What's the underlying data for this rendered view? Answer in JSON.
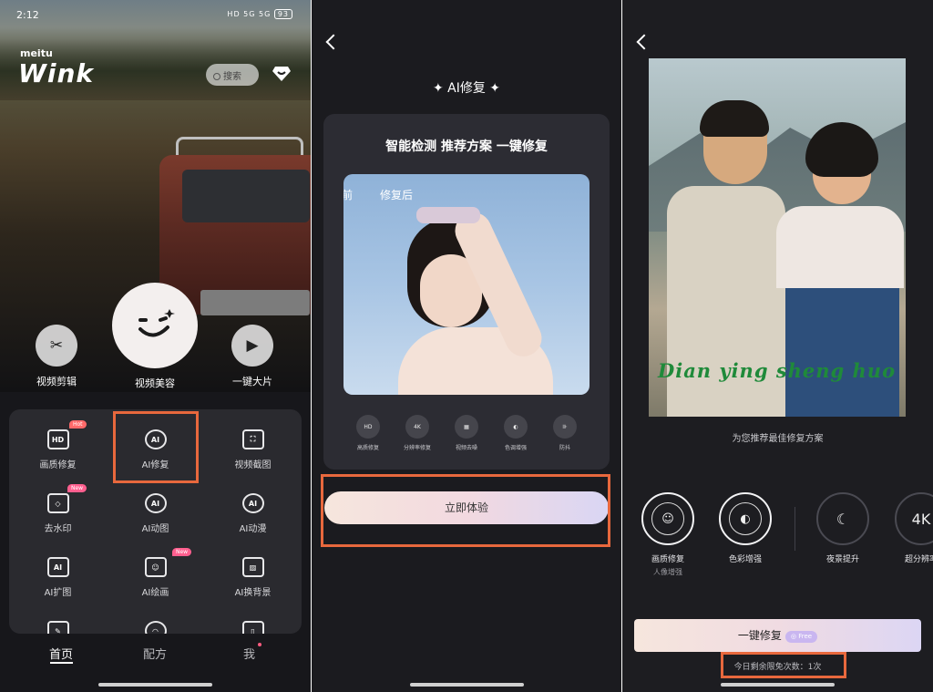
{
  "panel1": {
    "status": {
      "time": "2:12",
      "signal": "HD 5G 5G",
      "battery": "93"
    },
    "brand": {
      "top": "meitu",
      "name": "Wink"
    },
    "search_placeholder": "搜索",
    "features": [
      {
        "label": "视频剪辑",
        "icon": "scissors-icon"
      },
      {
        "label": "视频美容",
        "icon": "face-wink-icon"
      },
      {
        "label": "一键大片",
        "icon": "play-icon"
      }
    ],
    "tools": [
      {
        "label": "画质修复",
        "icon": "hd-icon",
        "tag": "Hot"
      },
      {
        "label": "AI修复",
        "icon": "ai-repair-icon",
        "tag": ""
      },
      {
        "label": "视频截图",
        "icon": "screenshot-icon",
        "tag": ""
      },
      {
        "label": "去水印",
        "icon": "eraser-icon",
        "tag": "New"
      },
      {
        "label": "AI动图",
        "icon": "ai-animate-icon",
        "tag": ""
      },
      {
        "label": "AI动漫",
        "icon": "ai-anime-icon",
        "tag": ""
      },
      {
        "label": "AI扩图",
        "icon": "ai-expand-icon",
        "tag": ""
      },
      {
        "label": "AI绘画",
        "icon": "ai-paint-icon",
        "tag": "New"
      },
      {
        "label": "AI换背景",
        "icon": "ai-background-icon",
        "tag": ""
      }
    ],
    "nav": {
      "home": "首页",
      "recipe": "配方",
      "me": "我"
    }
  },
  "panel2": {
    "title": "AI修复",
    "headline": "智能检测 推荐方案 一键修复",
    "before_label": "前",
    "after_label": "修复后",
    "options": [
      {
        "label": "高质修复",
        "icon": "HD"
      },
      {
        "label": "分辨率修复",
        "icon": "4K"
      },
      {
        "label": "视频去噪",
        "icon": "▦"
      },
      {
        "label": "色调增强",
        "icon": "◐"
      },
      {
        "label": "防抖",
        "icon": "⊪"
      }
    ],
    "try_button": "立即体验"
  },
  "panel3": {
    "caption": "Dian ying sheng huo",
    "subtitle": "为您推荐最佳修复方案",
    "options": [
      {
        "label": "画质修复",
        "sub": "人像增强",
        "icon": "☺"
      },
      {
        "label": "色彩增强",
        "sub": "",
        "icon": "◐"
      },
      {
        "label": "夜景提升",
        "sub": "",
        "icon": "☾"
      },
      {
        "label": "超分辨率",
        "sub": "",
        "icon": "4K"
      }
    ],
    "one_click_button": "一键修复",
    "free_badge": "Free",
    "remaining": "今日剩余限免次数：1次"
  }
}
